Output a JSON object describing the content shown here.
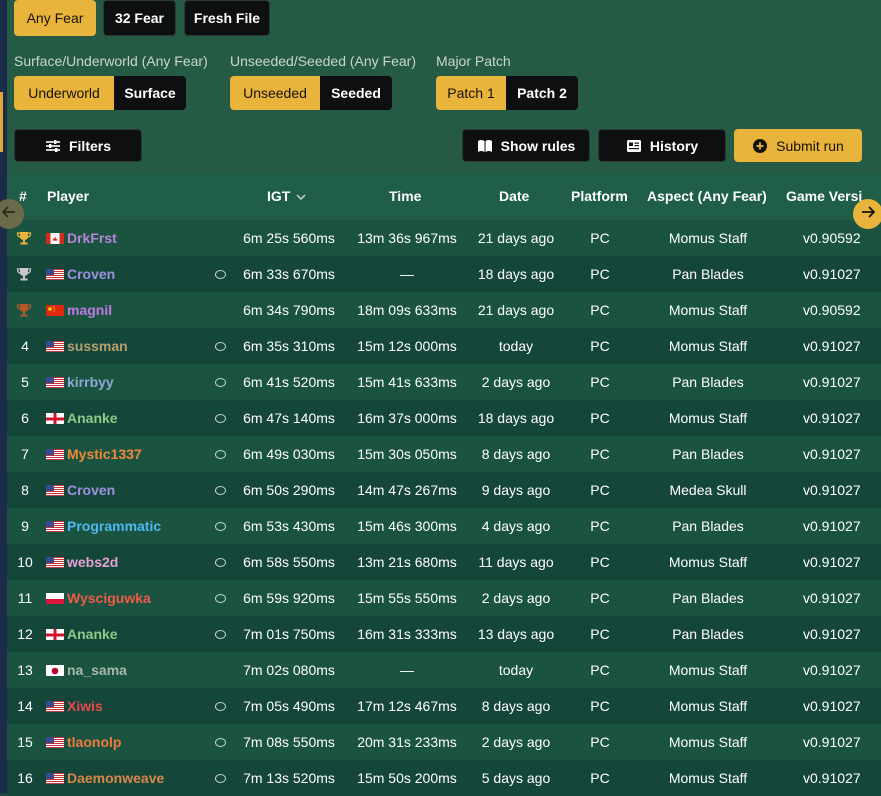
{
  "fear_tabs": [
    "Any Fear",
    "32 Fear",
    "Fresh File"
  ],
  "groups": [
    {
      "label": "Surface/Underworld (Any Fear)",
      "options": [
        "Underworld",
        "Surface"
      ]
    },
    {
      "label": "Unseeded/Seeded (Any Fear)",
      "options": [
        "Unseeded",
        "Seeded"
      ]
    },
    {
      "label": "Major Patch",
      "options": [
        "Patch 1",
        "Patch 2"
      ]
    }
  ],
  "toolbar": {
    "filters": "Filters",
    "show_rules": "Show rules",
    "history": "History",
    "submit": "Submit run"
  },
  "columns": {
    "rank": "#",
    "player": "Player",
    "igt": "IGT",
    "time": "Time",
    "date": "Date",
    "platform": "Platform",
    "aspect": "Aspect (Any Fear)",
    "version": "Game Versi"
  },
  "colors": {
    "accent": "#e9b43c",
    "gold_trophy": "#e8b53a",
    "silver_trophy": "#c9c9c9",
    "bronze_trophy": "#b05a2a"
  },
  "rows": [
    {
      "rank": "",
      "trophy": "gold",
      "flag": "ca",
      "player": "DrkFrst",
      "color": "#b784d6",
      "chat": false,
      "igt": "6m 25s 560ms",
      "time": "13m 36s 967ms",
      "date": "21 days ago",
      "platform": "PC",
      "aspect": "Momus Staff",
      "version": "v0.90592"
    },
    {
      "rank": "",
      "trophy": "silver",
      "flag": "us",
      "player": "Croven",
      "color": "#9d8fe0",
      "chat": true,
      "igt": "6m 33s 670ms",
      "time": "—",
      "date": "18 days ago",
      "platform": "PC",
      "aspect": "Pan Blades",
      "version": "v0.91027"
    },
    {
      "rank": "",
      "trophy": "bronze",
      "flag": "cn",
      "player": "magnil",
      "color": "#c07ae6",
      "chat": false,
      "igt": "6m 34s 790ms",
      "time": "18m 09s 633ms",
      "date": "21 days ago",
      "platform": "PC",
      "aspect": "Momus Staff",
      "version": "v0.90592"
    },
    {
      "rank": "4",
      "trophy": "",
      "flag": "us",
      "player": "sussman",
      "color": "#b7a070",
      "chat": true,
      "igt": "6m 35s 310ms",
      "time": "15m 12s 000ms",
      "date": "today",
      "platform": "PC",
      "aspect": "Momus Staff",
      "version": "v0.91027"
    },
    {
      "rank": "5",
      "trophy": "",
      "flag": "us",
      "player": "kirrbyy",
      "color": "#8fa8d8",
      "chat": true,
      "igt": "6m 41s 520ms",
      "time": "15m 41s 633ms",
      "date": "2 days ago",
      "platform": "PC",
      "aspect": "Pan Blades",
      "version": "v0.91027"
    },
    {
      "rank": "6",
      "trophy": "",
      "flag": "en",
      "player": "Ananke",
      "color": "#8fc98a",
      "chat": true,
      "igt": "6m 47s 140ms",
      "time": "16m 37s 000ms",
      "date": "18 days ago",
      "platform": "PC",
      "aspect": "Momus Staff",
      "version": "v0.91027"
    },
    {
      "rank": "7",
      "trophy": "",
      "flag": "us",
      "player": "Mystic1337",
      "color": "#f0883a",
      "chat": true,
      "igt": "6m 49s 030ms",
      "time": "15m 30s 050ms",
      "date": "8 days ago",
      "platform": "PC",
      "aspect": "Pan Blades",
      "version": "v0.91027"
    },
    {
      "rank": "8",
      "trophy": "",
      "flag": "us",
      "player": "Croven",
      "color": "#9d8fe0",
      "chat": true,
      "igt": "6m 50s 290ms",
      "time": "14m 47s 267ms",
      "date": "9 days ago",
      "platform": "PC",
      "aspect": "Medea Skull",
      "version": "v0.91027"
    },
    {
      "rank": "9",
      "trophy": "",
      "flag": "us",
      "player": "Programmatic",
      "color": "#4fb8f0",
      "chat": true,
      "igt": "6m 53s 430ms",
      "time": "15m 46s 300ms",
      "date": "4 days ago",
      "platform": "PC",
      "aspect": "Pan Blades",
      "version": "v0.91027"
    },
    {
      "rank": "10",
      "trophy": "",
      "flag": "us",
      "player": "webs2d",
      "color": "#e8a0d8",
      "chat": true,
      "igt": "6m 58s 550ms",
      "time": "13m 21s 680ms",
      "date": "11 days ago",
      "platform": "PC",
      "aspect": "Momus Staff",
      "version": "v0.91027"
    },
    {
      "rank": "11",
      "trophy": "",
      "flag": "pl",
      "player": "Wysciguwka",
      "color": "#f05a4a",
      "chat": true,
      "igt": "6m 59s 920ms",
      "time": "15m 55s 550ms",
      "date": "2 days ago",
      "platform": "PC",
      "aspect": "Pan Blades",
      "version": "v0.91027"
    },
    {
      "rank": "12",
      "trophy": "",
      "flag": "en",
      "player": "Ananke",
      "color": "#8fc98a",
      "chat": true,
      "igt": "7m 01s 750ms",
      "time": "16m 31s 333ms",
      "date": "13 days ago",
      "platform": "PC",
      "aspect": "Pan Blades",
      "version": "v0.91027"
    },
    {
      "rank": "13",
      "trophy": "",
      "flag": "jp",
      "player": "na_sama",
      "color": "#a7b8a8",
      "chat": false,
      "igt": "7m 02s 080ms",
      "time": "—",
      "date": "today",
      "platform": "PC",
      "aspect": "Momus Staff",
      "version": "v0.91027"
    },
    {
      "rank": "14",
      "trophy": "",
      "flag": "us",
      "player": "Xiwis",
      "color": "#e84a4a",
      "chat": true,
      "igt": "7m 05s 490ms",
      "time": "17m 12s 467ms",
      "date": "8 days ago",
      "platform": "PC",
      "aspect": "Momus Staff",
      "version": "v0.91027"
    },
    {
      "rank": "15",
      "trophy": "",
      "flag": "us",
      "player": "tlaonolp",
      "color": "#f07a3a",
      "chat": true,
      "igt": "7m 08s 550ms",
      "time": "20m 31s 233ms",
      "date": "2 days ago",
      "platform": "PC",
      "aspect": "Momus Staff",
      "version": "v0.91027"
    },
    {
      "rank": "16",
      "trophy": "",
      "flag": "us",
      "player": "Daemonweave",
      "color": "#d8884a",
      "chat": true,
      "igt": "7m 13s 520ms",
      "time": "15m 50s 200ms",
      "date": "5 days ago",
      "platform": "PC",
      "aspect": "Momus Staff",
      "version": "v0.91027"
    }
  ]
}
